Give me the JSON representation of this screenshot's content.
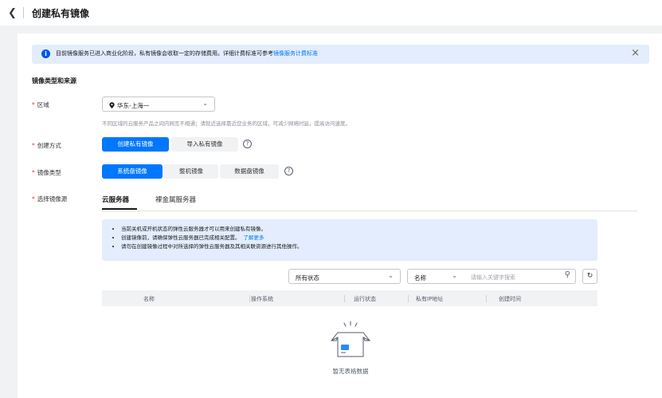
{
  "header": {
    "back_icon": "chevron-left-icon",
    "title": "创建私有镜像"
  },
  "notice": {
    "icon": "info-icon",
    "text": "目前镜像服务已进入商业化阶段，私有镜像会收取一定的存储费用。详细计费标准可参考",
    "link": "镜像服务计费标准",
    "close_icon": "close-icon"
  },
  "section": {
    "title": "镜像类型和来源"
  },
  "form": {
    "required_mark": "*",
    "region": {
      "label": "区域",
      "value": "华东-上海一",
      "icon": "location-pin-icon",
      "hint": "不同区域的云服务产品之间内网互不相通；请就近选择靠近您业务的区域，可减少网络时延，提高访问速度。"
    },
    "create_method": {
      "label": "创建方式",
      "options": [
        "创建私有镜像",
        "导入私有镜像"
      ],
      "selected": 0
    },
    "image_type": {
      "label": "镜像类型",
      "options": [
        "系统盘镜像",
        "整机镜像",
        "数据盘镜像"
      ],
      "selected": 0
    },
    "image_source": {
      "label": "选择镜像源"
    }
  },
  "tabs": [
    {
      "label": "云服务器",
      "active": true
    },
    {
      "label": "裸金属服务器",
      "active": false
    }
  ],
  "tips": {
    "items": [
      "当前关机或开机状态的弹性云服务器才可以用来创建私有镜像。",
      "创建镜像前，请确保弹性云服务器已完成相关配置。",
      "请勿在创建镜像过程中对所选择的弹性云服务器及其相关联资源进行其他操作。"
    ],
    "link": "了解更多"
  },
  "filters": {
    "status": "所有状态",
    "field": "名称",
    "search_placeholder": "请输入关键字搜索",
    "search_icon": "search-icon",
    "refresh_icon": "refresh-icon"
  },
  "table": {
    "columns": [
      "名称",
      "操作系统",
      "运行状态",
      "私有IP地址",
      "创建时间"
    ],
    "rows": [],
    "empty_text": "暂无表格数据",
    "empty_icon": "empty-box-icon"
  }
}
